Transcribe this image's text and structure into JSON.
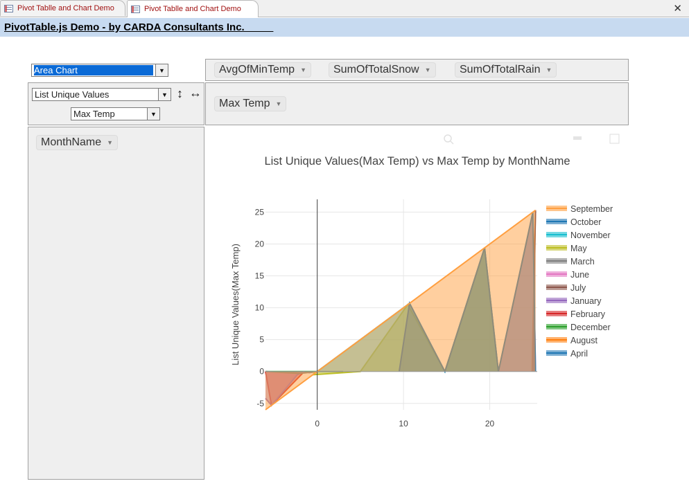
{
  "tabs": [
    {
      "label": "Pivot Tablle and Chart Demo",
      "active": false
    },
    {
      "label": "Pivot Tablle and Chart Demo",
      "active": true
    }
  ],
  "close_glyph": "✕",
  "header": {
    "title": "PivotTable.js Demo - by CARDA Consultants Inc.          "
  },
  "renderer_select": {
    "value": "Area Chart"
  },
  "aggregator_select": {
    "value": "List Unique Values"
  },
  "attribute_select": {
    "value": "Max Temp"
  },
  "sort_row_glyph": "↕",
  "sort_col_glyph": "↔",
  "unused_attributes": [
    "AvgOfMinTemp",
    "SumOfTotalSnow",
    "SumOfTotalRain"
  ],
  "column_attributes": [
    "Max Temp"
  ],
  "row_attributes": [
    "MonthName"
  ],
  "pill_arrow": "▼",
  "chart_data": {
    "type": "area",
    "title": "List Unique Values(Max Temp) vs Max Temp by MonthName",
    "xlabel": "",
    "ylabel": "List Unique Values(Max Temp)",
    "xlim": [
      -6,
      25.5
    ],
    "ylim": [
      -6,
      27
    ],
    "xticks": [
      0,
      10,
      20
    ],
    "yticks": [
      -5,
      0,
      5,
      10,
      15,
      20,
      25
    ],
    "legend_position": "right",
    "series": [
      {
        "name": "September",
        "color": "#ff9f40",
        "x": [
          -6,
          25.3
        ],
        "y": [
          -6,
          25.3
        ]
      },
      {
        "name": "October",
        "color": "#1f77b4",
        "x": [
          9.5,
          10.7,
          14.8,
          19.4,
          21.0,
          25.0,
          25.3
        ],
        "y": [
          0,
          10.7,
          0,
          19.4,
          0,
          25.0,
          0
        ]
      },
      {
        "name": "November",
        "color": "#17becf",
        "x": [
          0,
          10.7,
          14.8,
          19.4,
          21.0
        ],
        "y": [
          0,
          10.7,
          0,
          19.4,
          0
        ]
      },
      {
        "name": "May",
        "color": "#bcbd22",
        "x": [
          -0.5,
          5,
          10.5,
          14.8,
          19.4,
          21
        ],
        "y": [
          -0.5,
          0,
          10.5,
          0,
          19.4,
          0
        ]
      },
      {
        "name": "March",
        "color": "#7f7f7f",
        "x": [
          -6,
          -2,
          0,
          3
        ],
        "y": [
          0,
          -0.3,
          0,
          0
        ]
      },
      {
        "name": "June",
        "color": "#e377c2",
        "x": [
          21,
          25.0,
          25.3
        ],
        "y": [
          0,
          25.0,
          0
        ]
      },
      {
        "name": "July",
        "color": "#8c564b",
        "x": [
          25,
          25.3
        ],
        "y": [
          0,
          25.3
        ]
      },
      {
        "name": "January",
        "color": "#9467bd",
        "x": [
          -6,
          -5.3,
          -2.3,
          -1.5
        ],
        "y": [
          -4.2,
          -5.3,
          -0.5,
          0
        ]
      },
      {
        "name": "February",
        "color": "#d62728",
        "x": [
          -6,
          -5.3,
          -1.5
        ],
        "y": [
          0,
          -5.3,
          0
        ]
      },
      {
        "name": "December",
        "color": "#2ca02c",
        "x": [
          -6,
          0
        ],
        "y": [
          0,
          0
        ]
      },
      {
        "name": "August",
        "color": "#ff7f0e",
        "x": [
          24.9,
          25.3
        ],
        "y": [
          0,
          25.3
        ]
      },
      {
        "name": "April",
        "color": "#1f77b4",
        "x": [
          -1,
          0
        ],
        "y": [
          -0.2,
          0
        ]
      }
    ]
  }
}
